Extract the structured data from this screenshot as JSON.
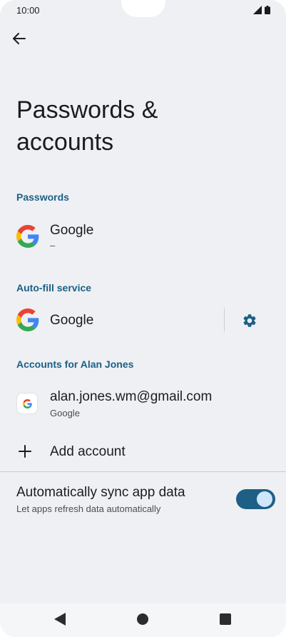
{
  "status_bar": {
    "time": "10:00"
  },
  "page": {
    "title": "Passwords & accounts"
  },
  "sections": {
    "passwords": {
      "header": "Passwords",
      "item": {
        "title": "Google",
        "subtitle": "–"
      }
    },
    "autofill": {
      "header": "Auto-fill service",
      "item": {
        "title": "Google"
      }
    },
    "accounts": {
      "header": "Accounts for Alan Jones",
      "account": {
        "email": "alan.jones.wm@gmail.com",
        "provider": "Google"
      },
      "add_label": "Add account"
    }
  },
  "sync": {
    "title": "Automatically sync app data",
    "subtitle": "Let apps refresh data automatically",
    "enabled": true
  },
  "colors": {
    "accent": "#1c5f86",
    "background": "#eef0f3"
  },
  "icons": [
    "signal-icon",
    "battery-icon",
    "back-arrow-icon",
    "google-logo-icon",
    "gear-icon",
    "plus-icon",
    "nav-back-icon",
    "nav-home-icon",
    "nav-recents-icon"
  ]
}
